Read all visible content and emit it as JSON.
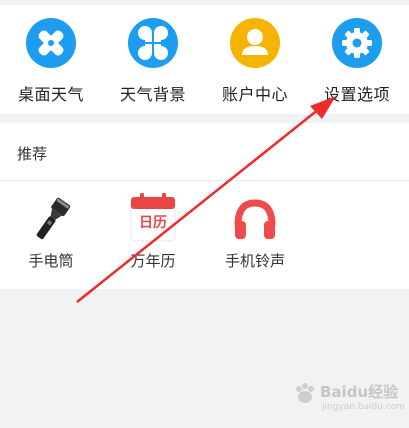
{
  "tools": [
    {
      "label": "桌面天气",
      "icon": "settings-cross-icon",
      "color": "#1c9df0"
    },
    {
      "label": "天气背景",
      "icon": "four-leaf-icon",
      "color": "#1c9df0"
    },
    {
      "label": "账户中心",
      "icon": "user-icon",
      "color": "#f5b400"
    },
    {
      "label": "设置选项",
      "icon": "gear-icon",
      "color": "#1c9df0"
    }
  ],
  "section": {
    "title": "推荐"
  },
  "apps": [
    {
      "label": "手电筒",
      "icon": "flashlight-icon"
    },
    {
      "label": "万年历",
      "icon": "calendar-icon",
      "icon_text": "日历",
      "color": "#e84545"
    },
    {
      "label": "手机铃声",
      "icon": "headphones-icon",
      "color": "#f04a4a"
    }
  ],
  "annotation": {
    "arrow_color": "#ee2a2a"
  },
  "watermark": {
    "main": "Baidu经验",
    "sub": "jingyan.baidu.com"
  }
}
